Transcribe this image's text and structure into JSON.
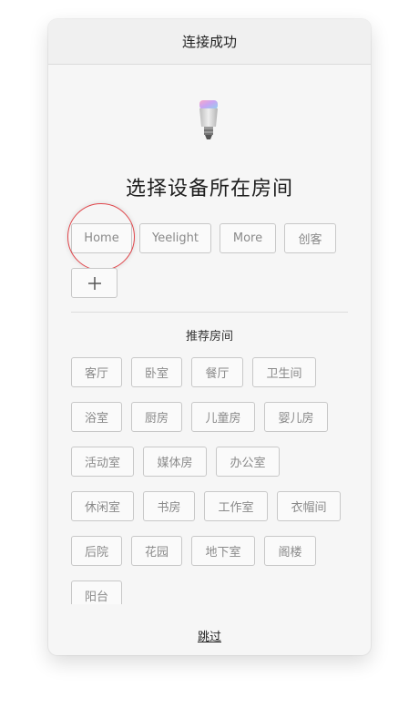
{
  "titlebar": {
    "title": "连接成功"
  },
  "device": {
    "icon": "smart-bulb-icon"
  },
  "heading": "选择设备所在房间",
  "existing_rooms": [
    {
      "label": "Home",
      "highlighted": true
    },
    {
      "label": "Yeelight"
    },
    {
      "label": "More"
    },
    {
      "label": "创客"
    }
  ],
  "add_room": {
    "icon": "plus-icon"
  },
  "recommended": {
    "title": "推荐房间",
    "rooms": [
      "客厅",
      "卧室",
      "餐厅",
      "卫生间",
      "浴室",
      "厨房",
      "儿童房",
      "婴儿房",
      "活动室",
      "媒体房",
      "办公室",
      "休闲室",
      "书房",
      "工作室",
      "衣帽间",
      "后院",
      "花园",
      "地下室",
      "阁楼",
      "阳台"
    ]
  },
  "skip_label": "跳过",
  "colors": {
    "highlight_ring": "#e0454a",
    "chip_border": "#c8c8c8",
    "chip_text": "#8a8a8a"
  }
}
